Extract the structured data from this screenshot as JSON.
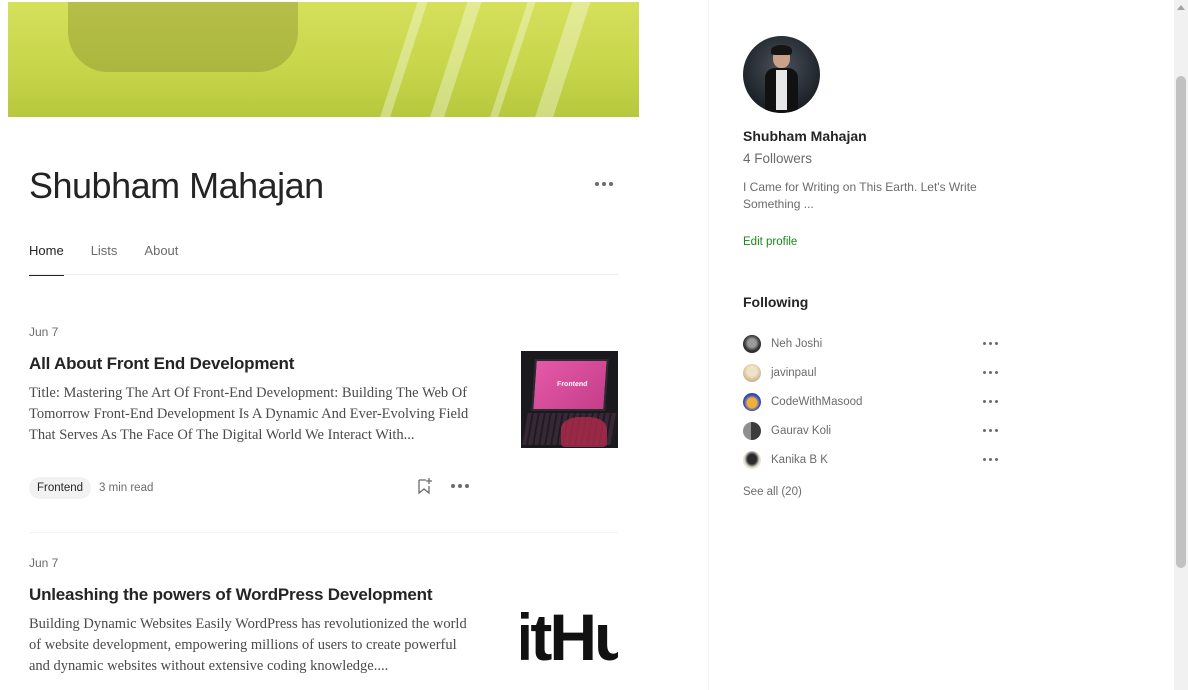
{
  "profile": {
    "name": "Shubham Mahajan",
    "followers": "4 Followers",
    "bio": "I Came for Writing on This Earth. Let's Write Something ...",
    "edit_profile": "Edit profile"
  },
  "tabs": [
    {
      "label": "Home",
      "active": true
    },
    {
      "label": "Lists",
      "active": false
    },
    {
      "label": "About",
      "active": false
    }
  ],
  "articles": [
    {
      "date": "Jun 7",
      "title": "All About Front End Development",
      "excerpt": "Title: Mastering The Art Of Front-End Development: Building The Web Of Tomorrow Front-End Development Is A Dynamic And Ever-Evolving Field That Serves As The Face Of The Digital World We Interact With...",
      "tag": "Frontend",
      "read_time": "3 min read",
      "thumb_text": "Frontend"
    },
    {
      "date": "Jun 7",
      "title": "Unleashing the powers of WordPress Development",
      "excerpt": "Building Dynamic Websites Easily WordPress has revolutionized the world of website development, empowering millions of users to create powerful and dynamic websites without extensive coding knowledge....",
      "thumb_text": "itHu"
    }
  ],
  "following": {
    "title": "Following",
    "items": [
      {
        "name": "Neh Joshi",
        "color": "#3b3b3b"
      },
      {
        "name": "javinpaul",
        "color": "#d8c39a"
      },
      {
        "name": "CodeWithMasood",
        "color": "#3a4fd0"
      },
      {
        "name": "Gaurav Koli",
        "color": "#555555"
      },
      {
        "name": "Kanika B K",
        "color": "#c9c0b8"
      }
    ],
    "see_all": "See all (20)"
  },
  "colors": {
    "accent_green": "#1a8917",
    "text_primary": "#242424",
    "text_secondary": "#6b6b6b",
    "banner": "#c7d64a"
  }
}
